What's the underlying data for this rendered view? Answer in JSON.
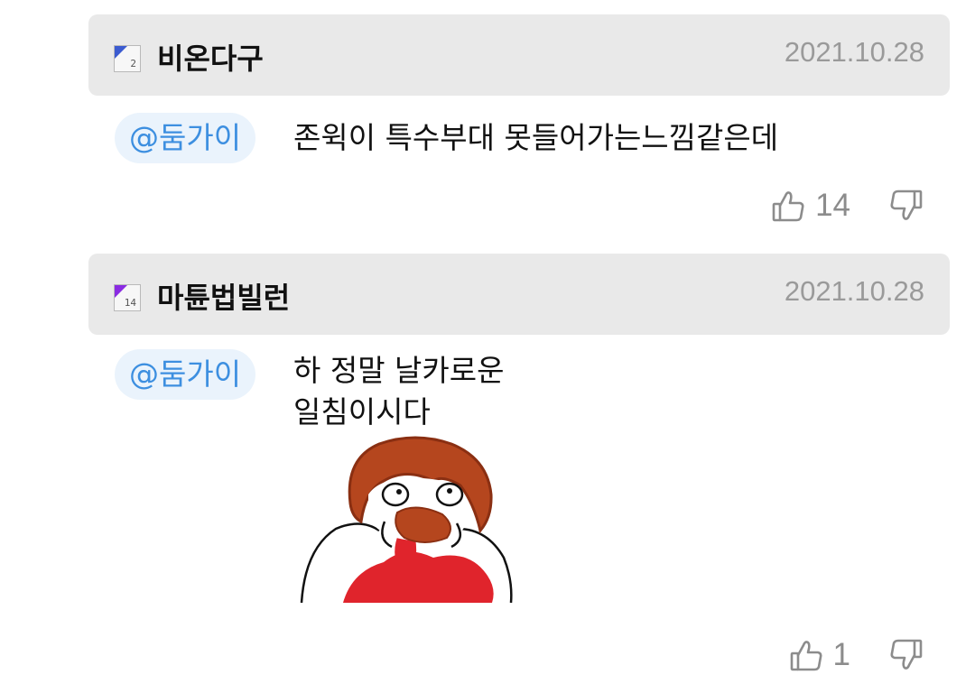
{
  "comments": [
    {
      "level": "2",
      "level_color": "#3b5bd0",
      "username": "비온다구",
      "date": "2021.10.28",
      "mention": "@둠가이",
      "text_lines": [
        "존윅이 특수부대 못들어가는느낌같은데"
      ],
      "likes": "14"
    },
    {
      "level": "14",
      "level_color": "#8a2be2",
      "username": "마튠법빌런",
      "date": "2021.10.28",
      "mention": "@둠가이",
      "text_lines": [
        "하 정말 날카로운",
        "일침이시다"
      ],
      "likes": "1"
    }
  ],
  "icons": {
    "like": "thumbs-up-icon",
    "dislike": "thumbs-down-icon"
  },
  "colors": {
    "mention_text": "#3d8fe0",
    "mention_bg": "#eaf3fc",
    "header_bg": "#e9e9e9",
    "date": "#9a9a9a"
  }
}
